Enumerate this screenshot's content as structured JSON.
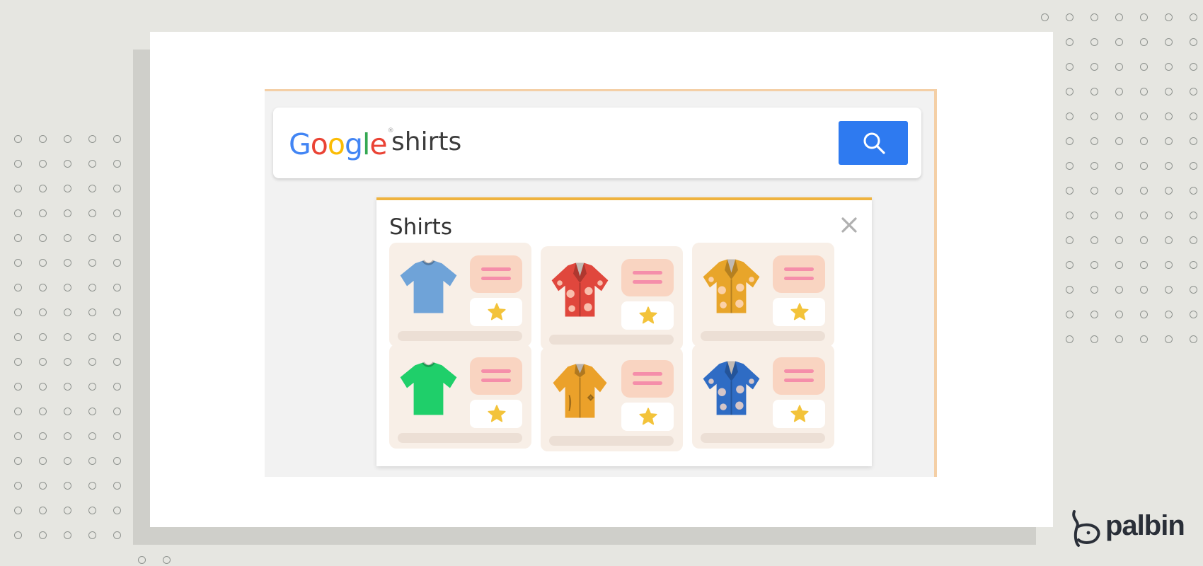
{
  "search": {
    "logo_letters": [
      {
        "ch": "G",
        "color": "#4285f4"
      },
      {
        "ch": "o",
        "color": "#ea4335"
      },
      {
        "ch": "o",
        "color": "#fbbc05"
      },
      {
        "ch": "g",
        "color": "#4285f4"
      },
      {
        "ch": "l",
        "color": "#34a853"
      },
      {
        "ch": "e",
        "color": "#ea4335"
      }
    ],
    "query": "shirts",
    "button_icon": "search-icon",
    "button_color": "#2e7af0"
  },
  "panel": {
    "title": "Shirts",
    "close_icon": "close-icon",
    "accent": "#efb33f",
    "products": [
      {
        "name": "blue-tshirt",
        "icon": "tshirt-icon",
        "color": "#6fa3d8"
      },
      {
        "name": "red-hawaiian-shirt",
        "icon": "hawaiian-shirt-icon",
        "color": "#e0473d"
      },
      {
        "name": "yellow-hawaiian-shirt",
        "icon": "hawaiian-shirt-icon",
        "color": "#e8a52a"
      },
      {
        "name": "green-tshirt",
        "icon": "tshirt-icon",
        "color": "#1fcf6a"
      },
      {
        "name": "orange-button-shirt",
        "icon": "button-shirt-icon",
        "color": "#eba12a"
      },
      {
        "name": "blue-hawaiian-shirt",
        "icon": "hawaiian-shirt-icon",
        "color": "#2f6cc4"
      }
    ]
  },
  "brand": {
    "name": "palbin",
    "icon": "palbin-logo-icon"
  }
}
